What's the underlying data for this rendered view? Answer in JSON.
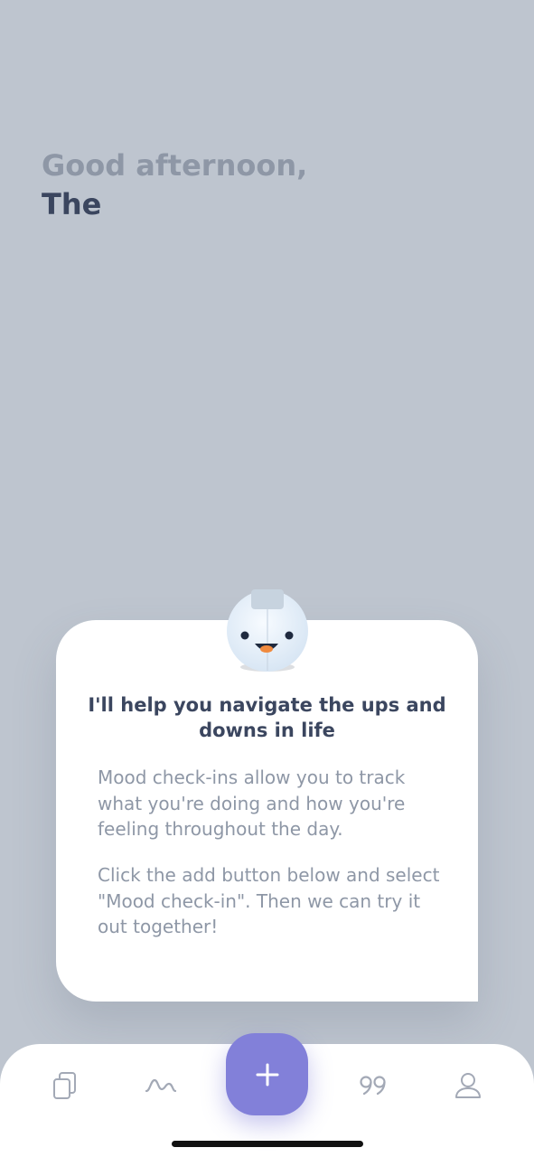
{
  "greeting": {
    "line1": "Good afternoon,",
    "line2": "The"
  },
  "onboarding_card": {
    "title": "I'll help you navigate the ups and downs in life",
    "paragraph1": "Mood check-ins allow you to track what you're doing and how you're feeling throughout the day.",
    "paragraph2": "Click the add button below and select \"Mood check-in\". Then we can try it out together!"
  },
  "tab_bar": {
    "items": [
      {
        "icon": "entries-icon"
      },
      {
        "icon": "stats-icon"
      },
      {
        "icon": "add-icon"
      },
      {
        "icon": "quotes-icon"
      },
      {
        "icon": "profile-icon"
      }
    ]
  },
  "colors": {
    "background": "#bec5cf",
    "accent": "#8280d9",
    "heading": "#3b465f",
    "muted_text": "#8e97a6"
  }
}
